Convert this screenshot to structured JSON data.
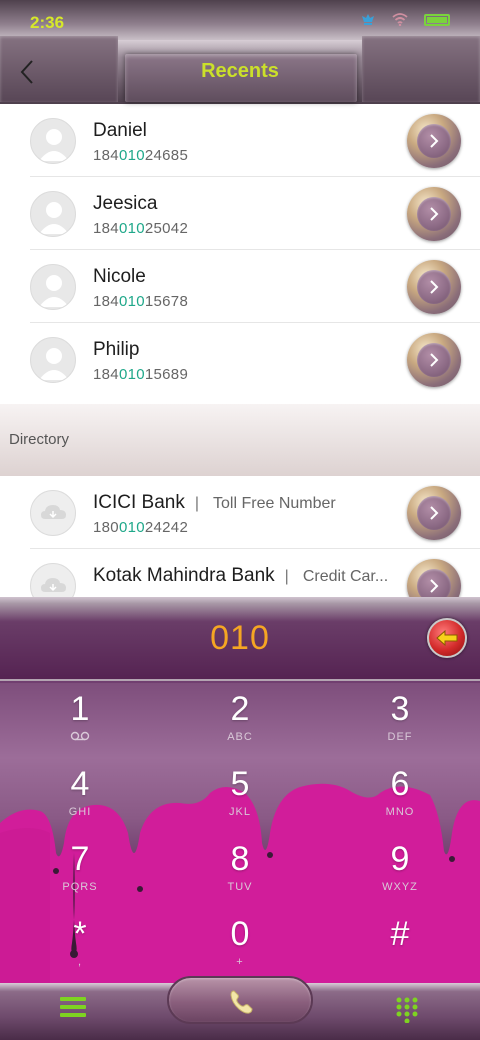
{
  "status_bar": {
    "time": "2:36"
  },
  "header": {
    "title": "Recents"
  },
  "recents": [
    {
      "name": "Daniel",
      "num_pre": "184",
      "num_match": "010",
      "num_post": "24685"
    },
    {
      "name": "Jeesica",
      "num_pre": "184",
      "num_match": "010",
      "num_post": "25042"
    },
    {
      "name": "Nicole",
      "num_pre": "184",
      "num_match": "010",
      "num_post": "15678"
    },
    {
      "name": "Philip",
      "num_pre": "184",
      "num_match": "010",
      "num_post": "15689"
    }
  ],
  "directory": {
    "label": "Directory",
    "items": [
      {
        "name": "ICICI Bank",
        "separator": "|",
        "tag": "Toll Free Number",
        "num_pre": "180",
        "num_match": "010",
        "num_post": "24242"
      },
      {
        "name": "Kotak Mahindra Bank",
        "separator": "|",
        "tag": "Credit Car...",
        "num_pre": "",
        "num_match": "",
        "num_post": ""
      }
    ]
  },
  "dialer": {
    "display": "010",
    "keys": [
      {
        "digit": "1",
        "letters": ""
      },
      {
        "digit": "2",
        "letters": "ABC"
      },
      {
        "digit": "3",
        "letters": "DEF"
      },
      {
        "digit": "4",
        "letters": "GHI"
      },
      {
        "digit": "5",
        "letters": "JKL"
      },
      {
        "digit": "6",
        "letters": "MNO"
      },
      {
        "digit": "7",
        "letters": "PQRS"
      },
      {
        "digit": "8",
        "letters": "TUV"
      },
      {
        "digit": "9",
        "letters": "WXYZ"
      },
      {
        "digit": "*",
        "letters": ","
      },
      {
        "digit": "0",
        "letters": "+"
      },
      {
        "digit": "#",
        "letters": ""
      }
    ]
  },
  "colors": {
    "accent_green": "#7ed321",
    "title_yellow": "#cbe02a",
    "display_orange": "#f5a623",
    "match_teal": "#1fa88a"
  },
  "icons": {
    "back": "chevron-left-icon",
    "go": "chevron-right-icon",
    "delete": "backspace-arrow-icon",
    "menu": "hamburger-icon",
    "call": "phone-icon",
    "keypad": "dialpad-icon",
    "voicemail": "voicemail-icon"
  }
}
